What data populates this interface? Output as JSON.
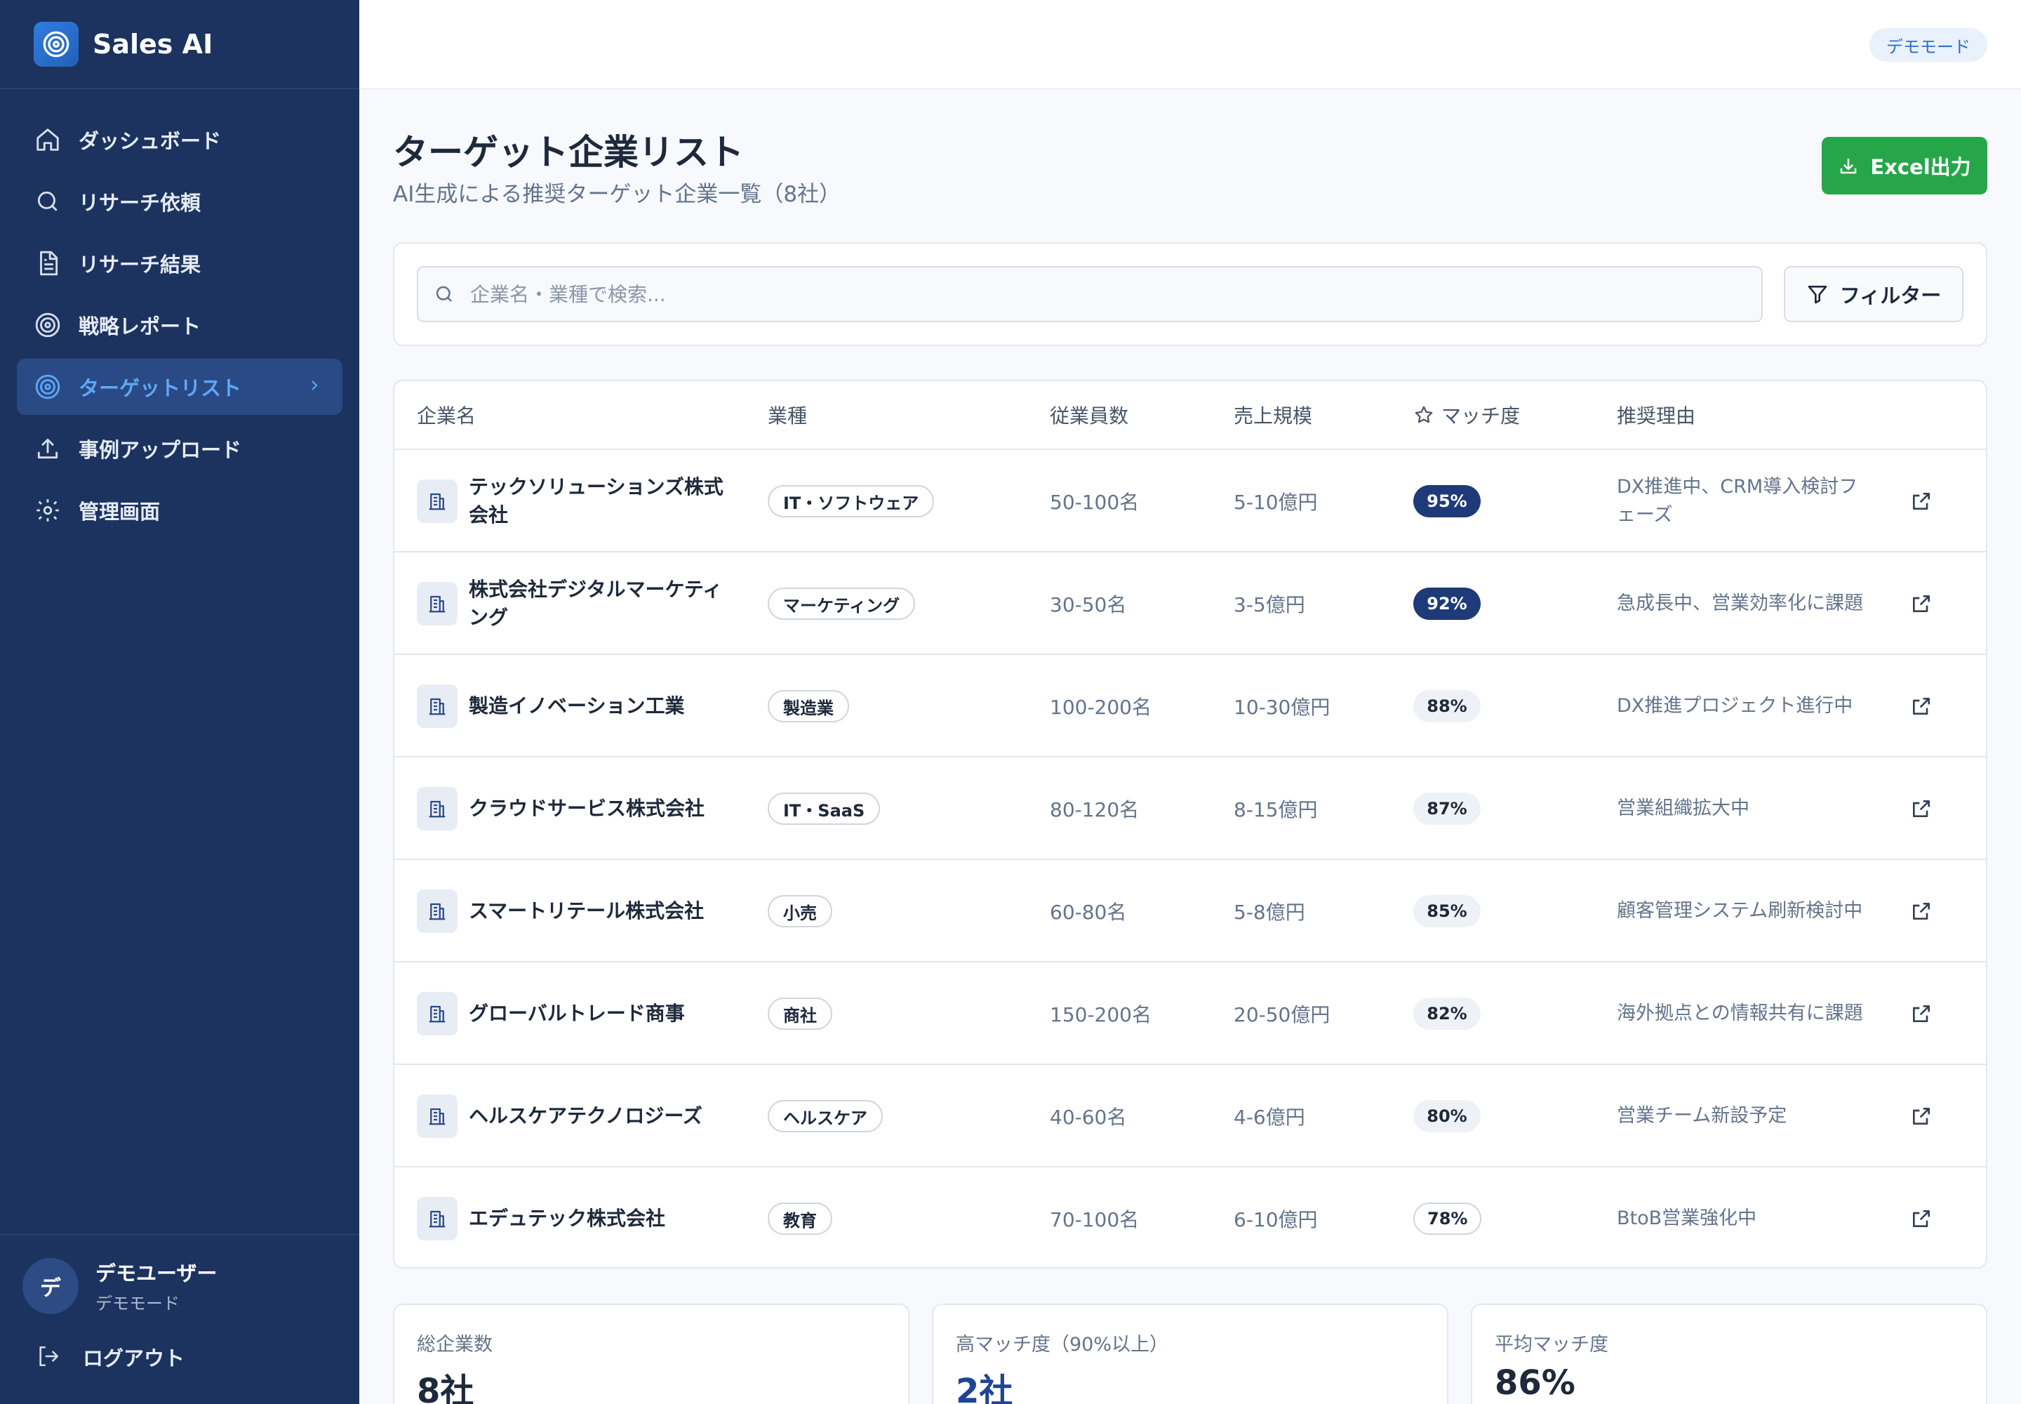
{
  "app": {
    "name": "Sales AI"
  },
  "nav": [
    {
      "label": "ダッシュボード",
      "icon": "home-icon"
    },
    {
      "label": "リサーチ依頼",
      "icon": "search-icon"
    },
    {
      "label": "リサーチ結果",
      "icon": "document-icon"
    },
    {
      "label": "戦略レポート",
      "icon": "target-icon"
    },
    {
      "label": "ターゲットリスト",
      "icon": "target-icon",
      "active": true
    },
    {
      "label": "事例アップロード",
      "icon": "upload-icon"
    },
    {
      "label": "管理画面",
      "icon": "gear-icon"
    }
  ],
  "user": {
    "avatar": "デ",
    "name": "デモユーザー",
    "mode": "デモモード",
    "logout": "ログアウト"
  },
  "topbar": {
    "badge": "デモモード"
  },
  "page": {
    "title": "ターゲット企業リスト",
    "subtitle": "AI生成による推奨ターゲット企業一覧（8社）",
    "export_label": "Excel出力"
  },
  "search": {
    "placeholder": "企業名・業種で検索...",
    "filter_label": "フィルター"
  },
  "table": {
    "headers": {
      "name": "企業名",
      "industry": "業種",
      "employees": "従業員数",
      "sales": "売上規模",
      "match": "マッチ度",
      "reason": "推奨理由"
    },
    "rows": [
      {
        "name": "テックソリューションズ株式会社",
        "industry": "IT・ソフトウェア",
        "employees": "50-100名",
        "sales": "5-10億円",
        "match": "95%",
        "reason": "DX推進中、CRM導入検討フェーズ"
      },
      {
        "name": "株式会社デジタルマーケティング",
        "industry": "マーケティング",
        "employees": "30-50名",
        "sales": "3-5億円",
        "match": "92%",
        "reason": "急成長中、営業効率化に課題"
      },
      {
        "name": "製造イノベーション工業",
        "industry": "製造業",
        "employees": "100-200名",
        "sales": "10-30億円",
        "match": "88%",
        "reason": "DX推進プロジェクト進行中"
      },
      {
        "name": "クラウドサービス株式会社",
        "industry": "IT・SaaS",
        "employees": "80-120名",
        "sales": "8-15億円",
        "match": "87%",
        "reason": "営業組織拡大中"
      },
      {
        "name": "スマートリテール株式会社",
        "industry": "小売",
        "employees": "60-80名",
        "sales": "5-8億円",
        "match": "85%",
        "reason": "顧客管理システム刷新検討中"
      },
      {
        "name": "グローバルトレード商事",
        "industry": "商社",
        "employees": "150-200名",
        "sales": "20-50億円",
        "match": "82%",
        "reason": "海外拠点との情報共有に課題"
      },
      {
        "name": "ヘルスケアテクノロジーズ",
        "industry": "ヘルスケア",
        "employees": "40-60名",
        "sales": "4-6億円",
        "match": "80%",
        "reason": "営業チーム新設予定"
      },
      {
        "name": "エデュテック株式会社",
        "industry": "教育",
        "employees": "70-100名",
        "sales": "6-10億円",
        "match": "78%",
        "reason": "BtoB営業強化中"
      }
    ]
  },
  "stats": [
    {
      "label": "総企業数",
      "value": "8社"
    },
    {
      "label": "高マッチ度（90%以上）",
      "value": "2社"
    },
    {
      "label": "平均マッチ度",
      "value": "86%"
    }
  ],
  "colors": {
    "sidebar": "#1c335f",
    "accent": "#5ea8f7",
    "export_button": "#27a649",
    "match_high": "#1e3a78"
  }
}
